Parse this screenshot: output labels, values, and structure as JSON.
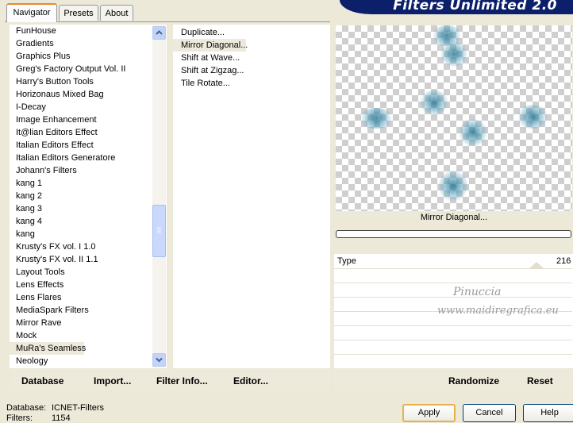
{
  "tabs": [
    {
      "label": "Navigator"
    },
    {
      "label": "Presets"
    },
    {
      "label": "About"
    }
  ],
  "banner": {
    "title": "Filters Unlimited 2.0"
  },
  "categories": {
    "items": [
      "FunHouse",
      "Gradients",
      "Graphics Plus",
      "Greg's Factory Output Vol. II",
      "Harry's Button Tools",
      "Horizonaus Mixed Bag",
      "I-Decay",
      "Image Enhancement",
      "It@lian Editors Effect",
      "Italian Editors Effect",
      "Italian Editors Generatore",
      "Johann's Filters",
      "kang 1",
      "kang 2",
      "kang 3",
      "kang 4",
      "kang",
      "Krusty's FX vol. I 1.0",
      "Krusty's FX vol. II 1.1",
      "Layout Tools",
      "Lens Effects",
      "Lens Flares",
      "MediaSpark Filters",
      "Mirror Rave",
      "Mock",
      "MuRa's Seamless",
      "Neology"
    ],
    "selected": "MuRa's Seamless"
  },
  "filters": {
    "items": [
      "Duplicate...",
      "Mirror Diagonal...",
      "Shift at Wave...",
      "Shift at Zigzag...",
      "Tile Rotate..."
    ],
    "selected": "Mirror Diagonal..."
  },
  "left_buttons": {
    "database": "Database",
    "import": "Import...",
    "filter_info": "Filter Info...",
    "editor": "Editor..."
  },
  "preview": {
    "filter_name": "Mirror Diagonal..."
  },
  "params": {
    "name": "Type",
    "value": "216"
  },
  "watermark": {
    "line1": "Pinuccia",
    "line2": "www.maidiregrafica.eu"
  },
  "right_buttons": {
    "randomize": "Randomize",
    "reset": "Reset"
  },
  "status": {
    "database_label": "Database:",
    "database_value": "ICNET-Filters",
    "filters_label": "Filters:",
    "filters_value": "1154"
  },
  "dialog_buttons": {
    "apply": "Apply",
    "cancel": "Cancel",
    "help": "Help"
  },
  "colors": {
    "banner": "#0b1f6b",
    "preview_blob": "#2c7c98",
    "selection": "#eeeadb"
  }
}
